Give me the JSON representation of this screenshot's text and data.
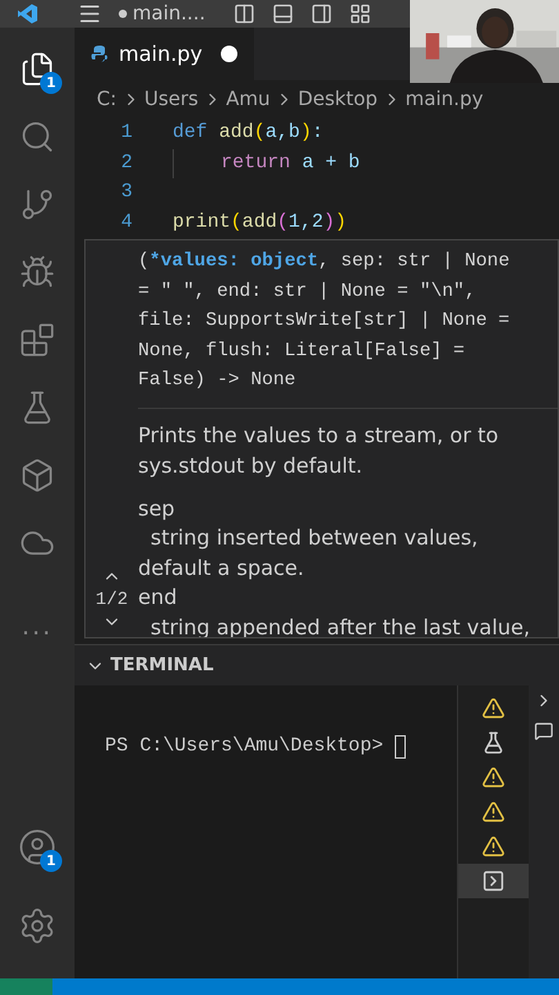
{
  "title_bar": {
    "title": "main....",
    "dirty": true
  },
  "activity_bar": {
    "items": [
      {
        "kind": "files",
        "badge": "1",
        "selected": true
      },
      {
        "kind": "search",
        "selected": false
      },
      {
        "kind": "branch",
        "selected": false
      },
      {
        "kind": "debug",
        "selected": false
      },
      {
        "kind": "extensions",
        "selected": false
      },
      {
        "kind": "flask",
        "selected": false
      },
      {
        "kind": "remote",
        "selected": false
      },
      {
        "kind": "cloud",
        "selected": false
      },
      {
        "kind": "more",
        "label": "..."
      }
    ],
    "bottom": [
      {
        "kind": "account",
        "badge": "1"
      },
      {
        "kind": "settings"
      }
    ]
  },
  "editor_tab": {
    "label": "main.py",
    "dirty": true
  },
  "breadcrumbs": [
    "C:",
    "Users",
    "Amu",
    "Desktop",
    "main.py"
  ],
  "code_lines": [
    {
      "number": "1",
      "tokens": [
        {
          "text": "def ",
          "kind": "keyword"
        },
        {
          "text": "add",
          "kind": "function"
        },
        {
          "text": "(",
          "kind": "paren"
        },
        {
          "text": "a,b",
          "kind": "plain"
        },
        {
          "text": ")",
          "kind": "paren"
        },
        {
          "text": ":",
          "kind": "plain"
        }
      ]
    },
    {
      "number": "2",
      "indent_guide": true,
      "tokens": [
        {
          "text": "return",
          "kind": "control"
        },
        {
          "text": " a + b",
          "kind": "plain"
        }
      ]
    },
    {
      "number": "3"
    },
    {
      "number": "4",
      "tokens": [
        {
          "text": "print",
          "kind": "function"
        },
        {
          "text": "(",
          "kind": "paren"
        },
        {
          "text": "add",
          "kind": "function"
        },
        {
          "text": "(",
          "kind": "paren2"
        },
        {
          "text": "1,2",
          "kind": "plain"
        },
        {
          "text": ")",
          "kind": "paren2"
        },
        {
          "text": ")",
          "kind": "paren"
        }
      ]
    }
  ],
  "hover": {
    "signature": [
      [
        {
          "text": "(",
          "kind": "plain"
        },
        {
          "text": "*values: object",
          "kind": "active"
        },
        {
          "text": ", sep: str | None",
          "kind": "plain"
        }
      ],
      [
        {
          "text": "= \" \", end: str | None = \"\\n\",",
          "kind": "plain"
        }
      ],
      [
        {
          "text": "file: SupportsWrite[str] | None =",
          "kind": "plain"
        }
      ],
      [
        {
          "text": "None, flush: Literal[False] =",
          "kind": "plain"
        }
      ],
      [
        {
          "text": "False) -> None",
          "kind": "plain"
        }
      ]
    ],
    "description": "Prints the values to a stream, or to sys.stdout by default.",
    "params": [
      {
        "name": "sep",
        "text": "string inserted between values, default a space."
      },
      {
        "name": "end",
        "text": "string appended after the last value,"
      }
    ],
    "pager": "1/2"
  },
  "panel": {
    "title": "TERMINAL",
    "expanded": true,
    "prompt": "PS C:\\Users\\Amu\\Desktop>",
    "terminals": [
      {
        "kind": "warning",
        "selected": false
      },
      {
        "kind": "flask",
        "selected": false
      },
      {
        "kind": "warning",
        "selected": false
      },
      {
        "kind": "warning",
        "selected": false
      },
      {
        "kind": "warning",
        "selected": false
      },
      {
        "kind": "shell",
        "selected": true
      }
    ]
  },
  "webcam": {
    "kind": "picture"
  }
}
